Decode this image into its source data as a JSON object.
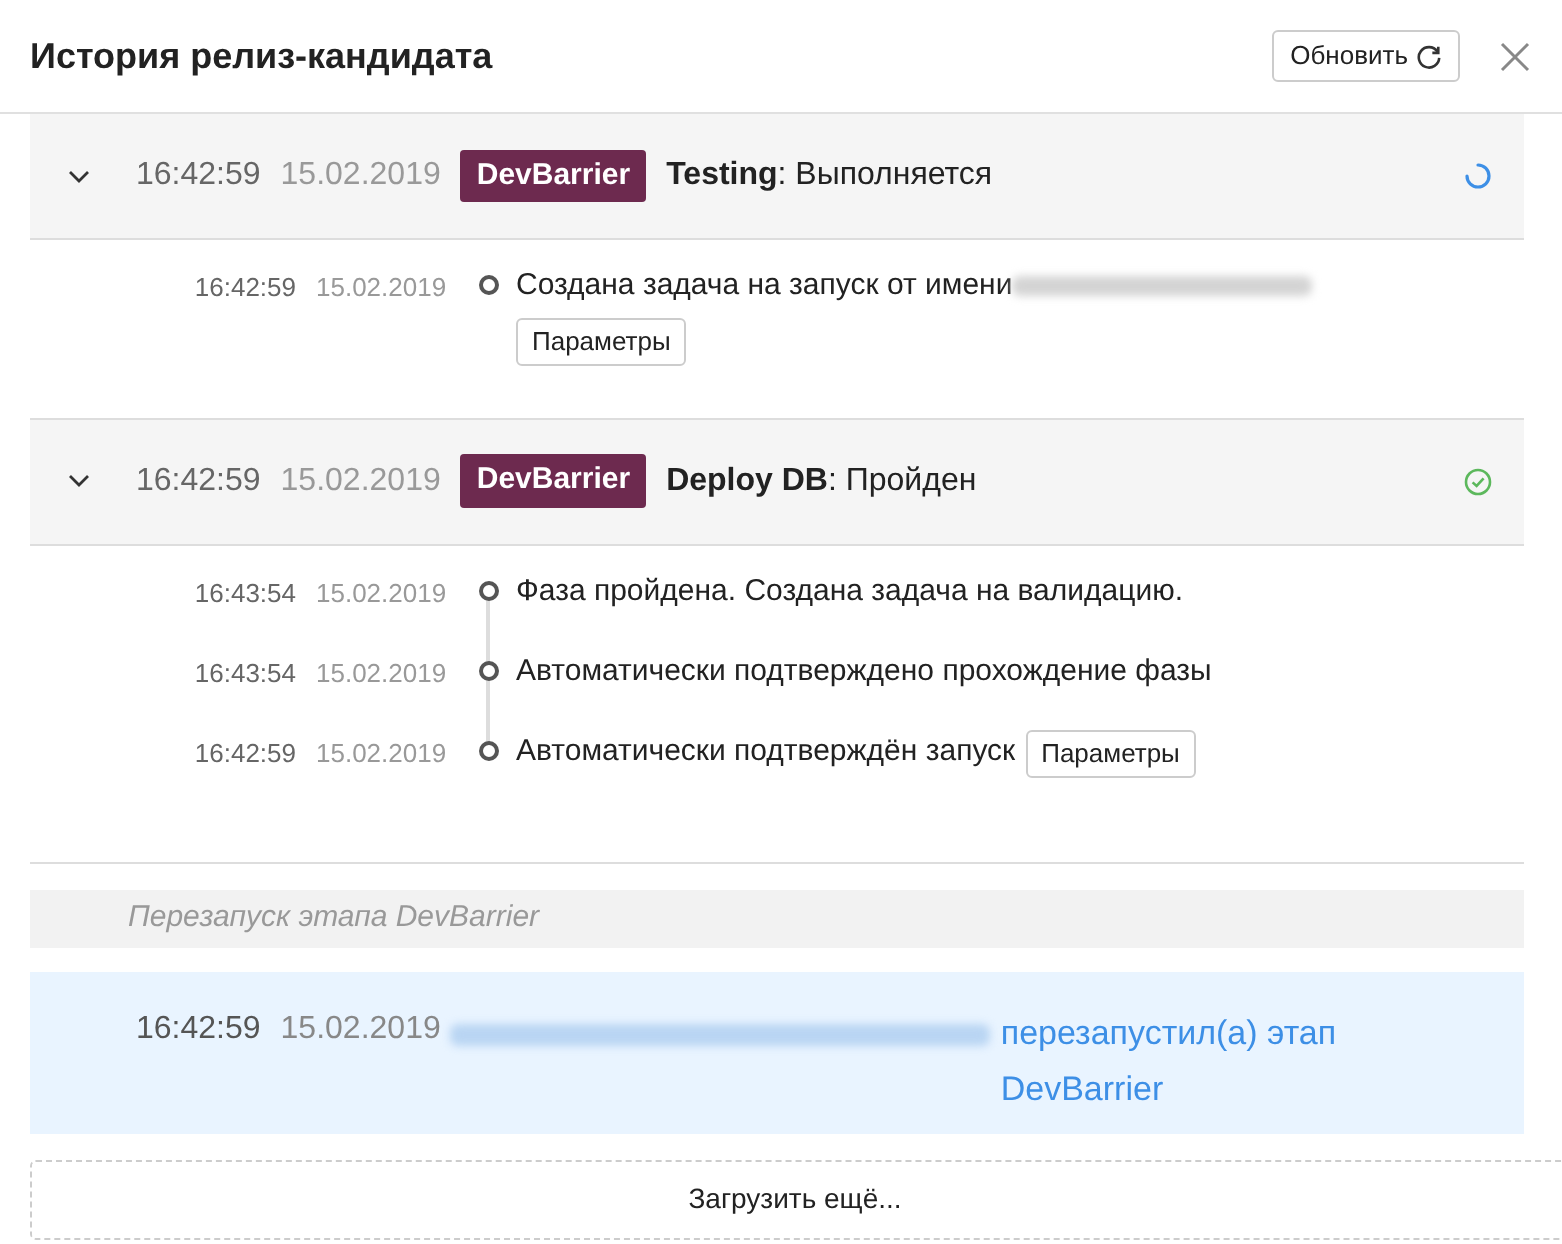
{
  "header": {
    "title": "История релиз-кандидата",
    "refresh_label": "Обновить"
  },
  "stages": [
    {
      "expanded": true,
      "time": "16:42:59",
      "date": "15.02.2019",
      "tag": "DevBarrier",
      "status_line": "**Testing**: Выполняется",
      "kind": "running",
      "events": [
        {
          "time": "16:42:59",
          "date": "15.02.2019",
          "text": "Создана задача на запуск от имени",
          "redacted_name": true,
          "params_button": "Параметры"
        }
      ]
    },
    {
      "expanded": true,
      "time": "16:42:59",
      "date": "15.02.2019",
      "tag": "DevBarrier",
      "status_line": "**Deploy DB**: Пройден",
      "kind": "passed",
      "events": [
        {
          "time": "16:43:54",
          "date": "15.02.2019",
          "text": "Фаза пройдена. Создана задача на валидацию."
        },
        {
          "time": "16:43:54",
          "date": "15.02.2019",
          "text": "Автоматически подтверждено прохождение фазы"
        },
        {
          "time": "16:42:59",
          "date": "15.02.2019",
          "text": "Автоматически подтверждён запуск",
          "params_button": "Параметры"
        }
      ]
    }
  ],
  "restart_note": "Перезапуск этапа DevBarrier",
  "restart_event": {
    "time": "16:42:59",
    "date": "15.02.2019",
    "redacted_user": true,
    "text": "перезапустил(а) этап DevBarrier"
  },
  "load_more": "Загрузить ещё..."
}
